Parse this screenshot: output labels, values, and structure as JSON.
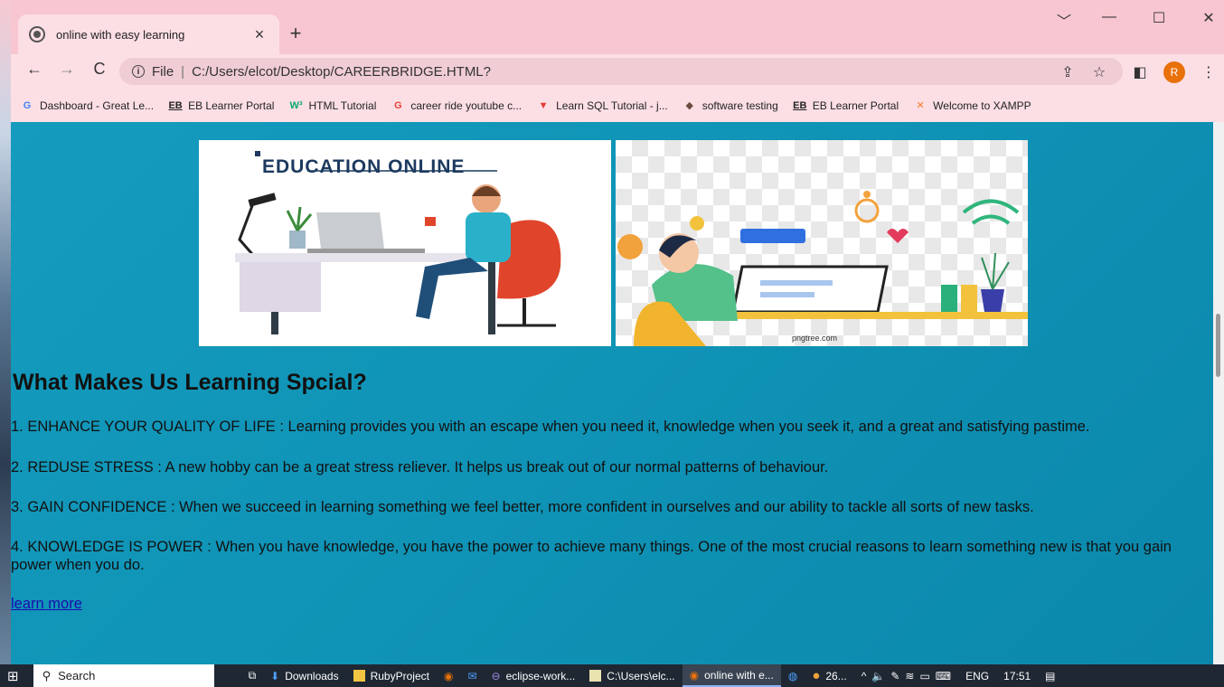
{
  "browser": {
    "tab_title": "online with easy learning",
    "tab_close": "×",
    "new_tab": "+",
    "address_prefix": "File",
    "address_url": "C:/Users/elcot/Desktop/CAREERBRIDGE.HTML?",
    "profile_initial": "R",
    "bookmarks": [
      {
        "label": "Dashboard - Great Le...",
        "icon": "G",
        "color": "#4285f4"
      },
      {
        "label": "EB Learner Portal",
        "icon": "EB",
        "color": "#222222"
      },
      {
        "label": "HTML Tutorial",
        "icon": "W³",
        "color": "#04aa6d"
      },
      {
        "label": "career ride youtube c...",
        "icon": "G",
        "color": "#ea4335"
      },
      {
        "label": "Learn SQL Tutorial - j...",
        "icon": "▼",
        "color": "#e53935"
      },
      {
        "label": "software testing",
        "icon": "◆",
        "color": "#6d4c41"
      },
      {
        "label": "EB Learner Portal",
        "icon": "EB",
        "color": "#222222"
      },
      {
        "label": "Welcome to XAMPP",
        "icon": "✕",
        "color": "#fb7a24"
      }
    ]
  },
  "page": {
    "image1_caption": "EDUCATION ONLINE",
    "image2_watermark": "pngtree.com",
    "heading": "What Makes Us Learning Spcial?",
    "points": [
      "1. ENHANCE YOUR QUALITY OF LIFE : Learning provides you with an escape when you need it, knowledge when you seek it, and a great and satisfying pastime.",
      "2. REDUSE STRESS : A new hobby can be a great stress reliever. It helps us break out of our normal patterns of behaviour.",
      "3. GAIN CONFIDENCE : When we succeed in learning something we feel better, more confident in ourselves and our ability to tackle all sorts of new tasks.",
      "4. KNOWLEDGE IS POWER : When you have knowledge, you have the power to achieve many things. One of the most crucial reasons to learn something new is that you gain power when you do."
    ],
    "link": "learn more"
  },
  "taskbar": {
    "search": "Search",
    "items": [
      "Downloads",
      "RubyProject",
      "eclipse-work...",
      "C:\\Users\\elc...",
      "online with e..."
    ],
    "weather": "26...",
    "language": "ENG",
    "time": "17:51"
  }
}
